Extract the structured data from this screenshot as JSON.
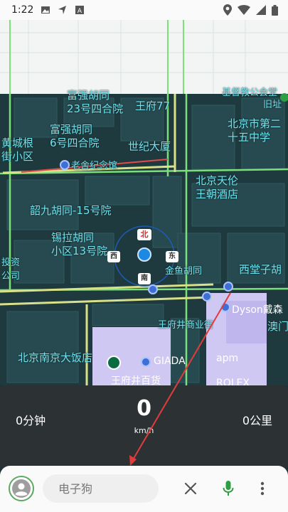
{
  "status_bar": {
    "time": "1:22",
    "icons": [
      "image-icon",
      "navigation-arrow-icon",
      "a-badge-icon",
      "location-pin-icon",
      "wifi-icon",
      "cell-signal-icon",
      "battery-icon"
    ]
  },
  "map": {
    "labels": [
      {
        "id": "fuqiang-23",
        "text": "富强胡同\n23号四合院"
      },
      {
        "id": "wangfu77",
        "text": "王府77"
      },
      {
        "id": "dongcheng-huangchenggen",
        "text": "黄城根\n街小区"
      },
      {
        "id": "fuqiang-6",
        "text": "富强胡同\n6号四合院"
      },
      {
        "id": "shiji-dasha",
        "text": "世纪大厦"
      },
      {
        "id": "laoshe",
        "text": "老舍纪念馆"
      },
      {
        "id": "beijing-no2",
        "text": "北京市第二\n十五中学"
      },
      {
        "id": "jiuzhi",
        "text": "旧址"
      },
      {
        "id": "top-right-label",
        "text": "基督教公会堂"
      },
      {
        "id": "beijing-tianlun",
        "text": "北京天伦\n王朝酒店"
      },
      {
        "id": "shaojiu",
        "text": "韶九胡同-15号院"
      },
      {
        "id": "xila",
        "text": "锡拉胡同\n小区13号院"
      },
      {
        "id": "touzi",
        "text": "投资\n公司"
      },
      {
        "id": "jinyu",
        "text": "金鱼胡同"
      },
      {
        "id": "xitangzi",
        "text": "西堂子胡"
      },
      {
        "id": "wangfujing-street",
        "text": "王府井商业街"
      },
      {
        "id": "dyson",
        "text": "Dyson戴森"
      },
      {
        "id": "aomen",
        "text": "澳门"
      },
      {
        "id": "beijing-nanjing",
        "text": "北京南京大饭店"
      },
      {
        "id": "giada",
        "text": "GIADA"
      },
      {
        "id": "apm",
        "text": "apm"
      },
      {
        "id": "wangfujing-baihuo",
        "text": "王府井百货"
      },
      {
        "id": "rolex",
        "text": "ROLEX"
      }
    ],
    "compass": {
      "north": "北",
      "east": "东",
      "south": "南",
      "west": "西"
    }
  },
  "speed_panel": {
    "time_left": "0分钟",
    "speed": "0",
    "speed_unit": "km/h",
    "distance": "0公里"
  },
  "bottom_bar": {
    "search_placeholder": "电子狗",
    "avatar_icon": "person-icon",
    "clear_icon": "close-icon",
    "voice_icon": "microphone-icon",
    "menu_icon": "more-vert-icon"
  },
  "colors": {
    "map_water_dark": "#1f3a3e",
    "label_cyan": "#6fe3ee",
    "road_green": "#7be07a",
    "road_yellow": "#d9e08a",
    "arrow_red": "#e23b3b",
    "panel_dark": "#2c3133",
    "accent_green": "#2e9e44"
  }
}
